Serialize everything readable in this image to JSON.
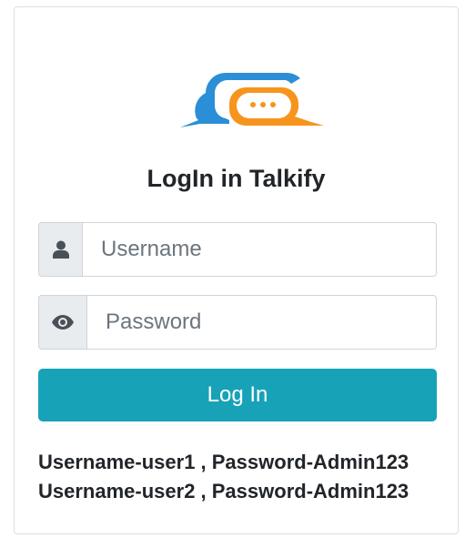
{
  "title": "LogIn in Talkify",
  "username": {
    "placeholder": "Username",
    "value": ""
  },
  "password": {
    "placeholder": "Password",
    "value": ""
  },
  "login_button": "Log In",
  "credentials": [
    "Username-user1 , Password-Admin123",
    "Username-user2 , Password-Admin123"
  ],
  "icons": {
    "logo": "chat-bubbles-logo",
    "username": "user-icon",
    "password": "eye-icon"
  },
  "colors": {
    "primary": "#17a2b8",
    "logo_blue": "#2a8fd6",
    "logo_orange": "#f7941d"
  }
}
